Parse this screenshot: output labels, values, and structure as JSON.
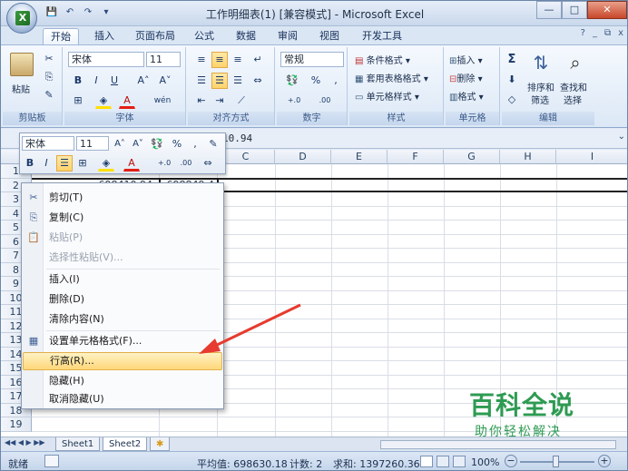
{
  "window": {
    "title": "工作明细表(1)  [兼容模式] - Microsoft Excel",
    "orb_letter": "X"
  },
  "qat": {
    "save": "💾",
    "undo": "↶",
    "redo": "↷",
    "more": "▾"
  },
  "winctl": {
    "min": "—",
    "max": "□",
    "close": "✕"
  },
  "tabs": [
    "开始",
    "插入",
    "页面布局",
    "公式",
    "数据",
    "审阅",
    "视图",
    "开发工具"
  ],
  "help": {
    "help": "?",
    "min": "_",
    "restore": "⧉",
    "close": "x"
  },
  "ribbon": {
    "clipboard": {
      "label": "剪贴板",
      "paste": "粘贴"
    },
    "font": {
      "label": "字体",
      "name": "宋体",
      "size": "11",
      "bold": "B",
      "italic": "I",
      "underline": "U",
      "grow": "A˄",
      "shrink": "A˅",
      "color": "A",
      "special": "wén"
    },
    "alignment": {
      "label": "对齐方式"
    },
    "number": {
      "label": "数字",
      "format": "常规",
      "percent": "%",
      "comma": ",",
      "inc": "+.0 .00",
      "dec": ".00 +.0"
    },
    "styles": {
      "label": "样式",
      "cond": "条件格式",
      "table": "套用表格格式",
      "cell": "单元格样式"
    },
    "cells": {
      "label": "单元格",
      "insert": "插入",
      "delete": "删除",
      "format": "格式"
    },
    "editing": {
      "label": "编辑",
      "sum": "Σ",
      "sort": "排序和",
      "sort2": "筛选",
      "find": "查找和",
      "find2": "选择"
    }
  },
  "formula": {
    "value": "10.94"
  },
  "columns": [
    "C",
    "D",
    "E",
    "F",
    "G",
    "H",
    "I"
  ],
  "rows": [
    "1",
    "2",
    "3",
    "4",
    "5",
    "6",
    "7",
    "8",
    "9",
    "10",
    "11",
    "12",
    "13",
    "14",
    "15",
    "16",
    "17",
    "18",
    "19"
  ],
  "cells": {
    "a2": "698410.94",
    "b2": "698849.4"
  },
  "mini_toolbar": {
    "font": "宋体",
    "size": "11",
    "grow": "A˄",
    "shrink": "A˅",
    "percent": "%",
    "comma": ",",
    "bold": "B",
    "italic": "I",
    "color": "A",
    "inc": "+.0",
    "dec": ".00"
  },
  "context_menu": [
    {
      "label": "剪切(T)",
      "icon": "scissors-icon",
      "glyph": "✂"
    },
    {
      "label": "复制(C)",
      "icon": "copy-icon",
      "glyph": "⎘"
    },
    {
      "label": "粘贴(P)",
      "icon": "paste-icon",
      "glyph": "📋",
      "disabled": true
    },
    {
      "label": "选择性粘贴(V)...",
      "disabled": true
    },
    {
      "label": "插入(I)"
    },
    {
      "label": "删除(D)"
    },
    {
      "label": "清除内容(N)"
    },
    {
      "label": "设置单元格格式(F)...",
      "icon": "format-cells-icon",
      "glyph": "▦"
    },
    {
      "label": "行高(R)...",
      "highlighted": true
    },
    {
      "label": "隐藏(H)"
    },
    {
      "label": "取消隐藏(U)"
    }
  ],
  "sheets": {
    "nav": "◀◀ ◀ ▶ ▶▶",
    "tab1": "Sheet1",
    "tab2": "Sheet2",
    "add": "✱"
  },
  "status": {
    "ready": "就绪",
    "average": "平均值: 698630.18",
    "count": "计数: 2",
    "sum": "求和: 1397260.36",
    "zoom": "100%",
    "zoom_out": "−",
    "zoom_in": "+"
  },
  "watermark": {
    "big": "百科全说",
    "small": "助你轻松解决"
  },
  "colors": {
    "accent": "#2e9b52",
    "arrow": "#e63b2e",
    "highlight": "#ffd77a"
  }
}
